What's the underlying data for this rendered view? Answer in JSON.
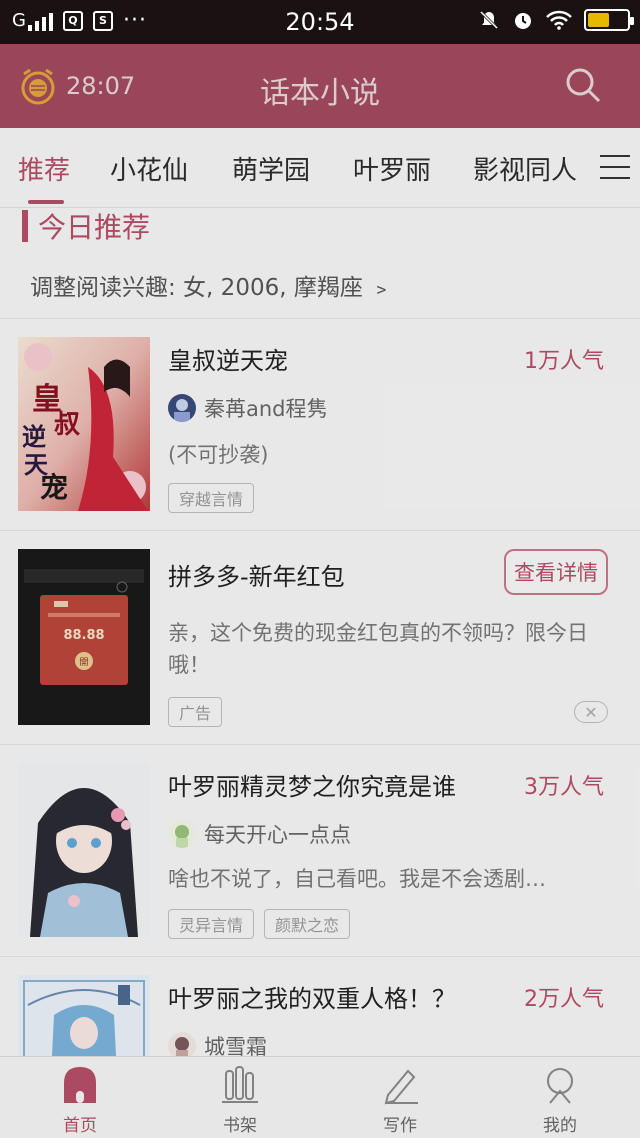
{
  "status_bar": {
    "network": "G",
    "time": "20:54",
    "more": "···"
  },
  "header": {
    "timer": "28:07",
    "title": "话本小说"
  },
  "tabs": [
    {
      "label": "推荐"
    },
    {
      "label": "小花仙"
    },
    {
      "label": "萌学园"
    },
    {
      "label": "叶罗丽"
    },
    {
      "label": "影视同人"
    }
  ],
  "section": {
    "title": "今日推荐",
    "interest": "调整阅读兴趣: 女, 2006, 摩羯座 ﹥"
  },
  "items": [
    {
      "title": "皇叔逆天宠",
      "popularity": "1万人气",
      "author": "秦苒and程隽",
      "desc": "(不可抄袭)",
      "tags": [
        "穿越言情"
      ],
      "cover_text": "皇叔逆天宠"
    },
    {
      "title": "拼多多-新年红包",
      "detail_button": "查看详情",
      "desc": "亲，这个免费的现金红包真的不领吗？限今日哦！",
      "tags": [
        "广告"
      ],
      "ad_amount": "88.88",
      "ad_open": "開"
    },
    {
      "title": "叶罗丽精灵梦之你究竟是谁",
      "popularity": "3万人气",
      "author": "每天开心一点点",
      "desc": "啥也不说了，自己看吧。我是不会透剧…",
      "tags": [
        "灵异言情",
        "颜默之恋"
      ]
    },
    {
      "title": "叶罗丽之我的双重人格！？",
      "popularity": "2万人气",
      "author": "城雪霜"
    }
  ],
  "bottom_nav": [
    {
      "label": "首页"
    },
    {
      "label": "书架"
    },
    {
      "label": "写作"
    },
    {
      "label": "我的"
    }
  ]
}
